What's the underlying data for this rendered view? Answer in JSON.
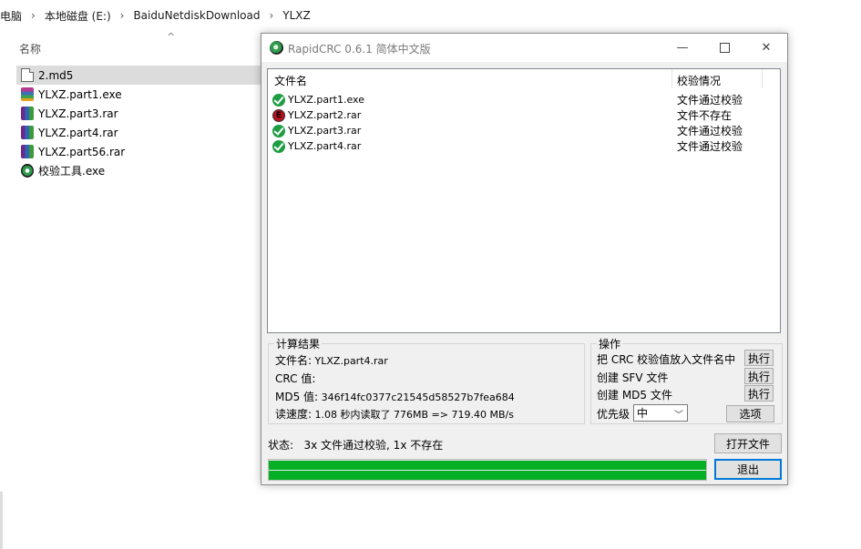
{
  "explorer": {
    "breadcrumb": [
      "此电脑",
      "本地磁盘 (E:)",
      "BaiduNetdiskDownload",
      "YLXZ"
    ],
    "column_header": "名称",
    "files": [
      {
        "name": "2.md5",
        "icon": "document-icon",
        "selected": true
      },
      {
        "name": "YLXZ.part1.exe",
        "icon": "exe-icon",
        "selected": false
      },
      {
        "name": "YLXZ.part3.rar",
        "icon": "rar-icon",
        "selected": false
      },
      {
        "name": "YLXZ.part4.rar",
        "icon": "rar-icon",
        "selected": false
      },
      {
        "name": "YLXZ.part56.rar",
        "icon": "rar-icon",
        "selected": false
      },
      {
        "name": "校验工具.exe",
        "icon": "tool-icon",
        "selected": false
      }
    ]
  },
  "window": {
    "title": "RapidCRC 0.6.1 简体中文版",
    "list": {
      "col_name": "文件名",
      "col_status": "校验情况",
      "rows": [
        {
          "name": "YLXZ.part1.exe",
          "status": "文件通过校验",
          "ok": true
        },
        {
          "name": "YLXZ.part2.rar",
          "status": "文件不存在",
          "ok": false
        },
        {
          "name": "YLXZ.part3.rar",
          "status": "文件通过校验",
          "ok": true
        },
        {
          "name": "YLXZ.part4.rar",
          "status": "文件通过校验",
          "ok": true
        }
      ]
    },
    "results": {
      "title": "计算结果",
      "filename_label": "文件名:",
      "filename_value": "YLXZ.part4.rar",
      "crc_label": "CRC 值:",
      "crc_value": "",
      "md5_label": "MD5 值:",
      "md5_value": "346f14fc0377c21545d58527b7fea684",
      "speed_label": "读速度:",
      "speed_value": "1.08 秒内读取了 776MB => 719.40 MB/s"
    },
    "ops": {
      "title": "操作",
      "op1": "把 CRC 校验值放入文件名中",
      "op2": "创建 SFV 文件",
      "op3": "创建 MD5 文件",
      "exec": "执行",
      "priority_label": "优先级",
      "priority_value": "中",
      "options_button": "选项"
    },
    "status_label": "状态:",
    "status_text": "3x 文件通过校验, 1x 不存在",
    "open_button": "打开文件",
    "exit_button": "退出",
    "progress": 1.0
  },
  "colors": {
    "progress": "#06b025",
    "ok": "#1f9d44",
    "bad": "#b3121f"
  }
}
